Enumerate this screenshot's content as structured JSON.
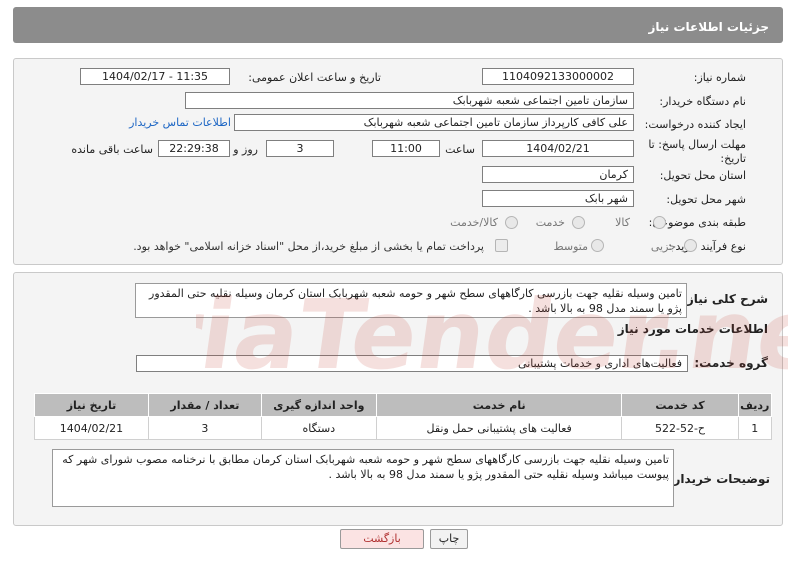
{
  "header": {
    "title": "جزئیات اطلاعات نیاز"
  },
  "form": {
    "need_number_label": "شماره نیاز:",
    "need_number": "1104092133000002",
    "announce_label": "تاریخ و ساعت اعلان عمومی:",
    "announce_value": "1404/02/17 - 11:35",
    "buyer_org_label": "نام دستگاه خریدار:",
    "buyer_org": "سازمان تامین اجتماعی شعبه شهربابک",
    "requester_label": "ایجاد کننده درخواست:",
    "requester": "علی کافی کارپرداز سازمان تامین اجتماعی شعبه شهربابک",
    "contact_link": "اطلاعات تماس خریدار",
    "deadline_label": "مهلت ارسال پاسخ: تا تاریخ:",
    "deadline_date": "1404/02/21",
    "time_label": "ساعت",
    "deadline_time": "11:00",
    "days_value": "3",
    "days_label": "روز و",
    "remaining_time": "22:29:38",
    "remaining_label": "ساعت باقی مانده",
    "province_label": "استان محل تحویل:",
    "province": "کرمان",
    "city_label": "شهر محل تحویل:",
    "city": "شهر بابک",
    "category_label": "طبقه بندی موضوعی:",
    "category_options": [
      "کالا",
      "خدمت",
      "کالا/خدمت"
    ],
    "process_label": "نوع فرآیند خرید :",
    "process_options": [
      "جزیی",
      "متوسط"
    ],
    "payment_note": "پرداخت تمام یا بخشی از مبلغ خرید،از محل \"اسناد خزانه اسلامی\" خواهد بود."
  },
  "summary": {
    "label": "شرح کلی نیاز:",
    "text": "تامین وسیله نقلیه جهت بازرسی کارگاههای سطح شهر و حومه شعبه شهربابک استان کرمان وسیله نقلیه حتی المقدور پژو یا سمند مدل 98 به بالا باشد ."
  },
  "services": {
    "section_title": "اطلاعات خدمات مورد نیاز",
    "group_label": "گروه خدمت:",
    "group_value": "فعالیت‌های اداری و خدمات پشتیبانی",
    "columns": [
      "ردیف",
      "کد خدمت",
      "نام خدمت",
      "واحد اندازه گیری",
      "تعداد / مقدار",
      "تاریخ نیاز"
    ],
    "rows": [
      [
        "1",
        "ح-52-522",
        "فعالیت های پشتیبانی حمل ونقل",
        "دستگاه",
        "3",
        "1404/02/21"
      ]
    ]
  },
  "buyer_notes": {
    "label": "توضیحات خریدار:",
    "text": "تامین وسیله نقلیه جهت بازرسی کارگاههای سطح شهر و حومه شعبه شهربابک استان کرمان مطابق با نرخنامه مصوب شورای شهر که پیوست میباشد وسیله نقلیه حتی المقدور پژو یا سمند مدل 98 به بالا باشد ."
  },
  "buttons": {
    "print": "چاپ",
    "back": "بازگشت"
  },
  "watermark_text": "AriaTender.neT",
  "colors": {
    "title_bar": "#8c8c8c",
    "link": "#1d66c4",
    "back_button": "#fbe3e3",
    "watermark": "#c0392b"
  }
}
